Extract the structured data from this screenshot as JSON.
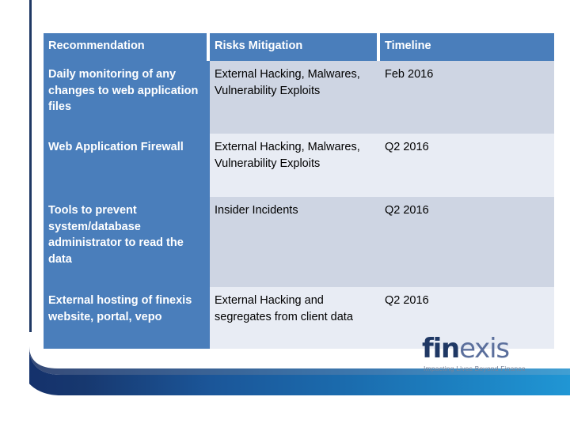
{
  "slide": {
    "background_color": "#ffffff",
    "accent_navy": "#1f3864",
    "accent_blue": "#4a7ebb",
    "row_dark": "#ced5e3",
    "row_light": "#e8ecf4"
  },
  "table": {
    "headers": [
      "Recommendation",
      "Risks Mitigation",
      "Timeline"
    ],
    "rows": [
      {
        "recommendation": "Daily monitoring of any changes to web application files",
        "risks": "External Hacking, Malwares, Vulnerability Exploits",
        "timeline": "Feb 2016"
      },
      {
        "recommendation": "Web Application Firewall",
        "risks": "External Hacking, Malwares, Vulnerability Exploits",
        "timeline": "Q2 2016"
      },
      {
        "recommendation": "Tools to prevent system/database administrator to read the data",
        "risks": "Insider Incidents",
        "timeline": "Q2 2016"
      },
      {
        "recommendation": "External hosting of finexis website, portal, vepo",
        "risks": "External Hacking and segregates from client data",
        "timeline": "Q2 2016"
      }
    ]
  },
  "logo": {
    "word_part1": "fin",
    "word_part2": "exis",
    "tagline": "Impacting Lives Beyond Finance"
  }
}
